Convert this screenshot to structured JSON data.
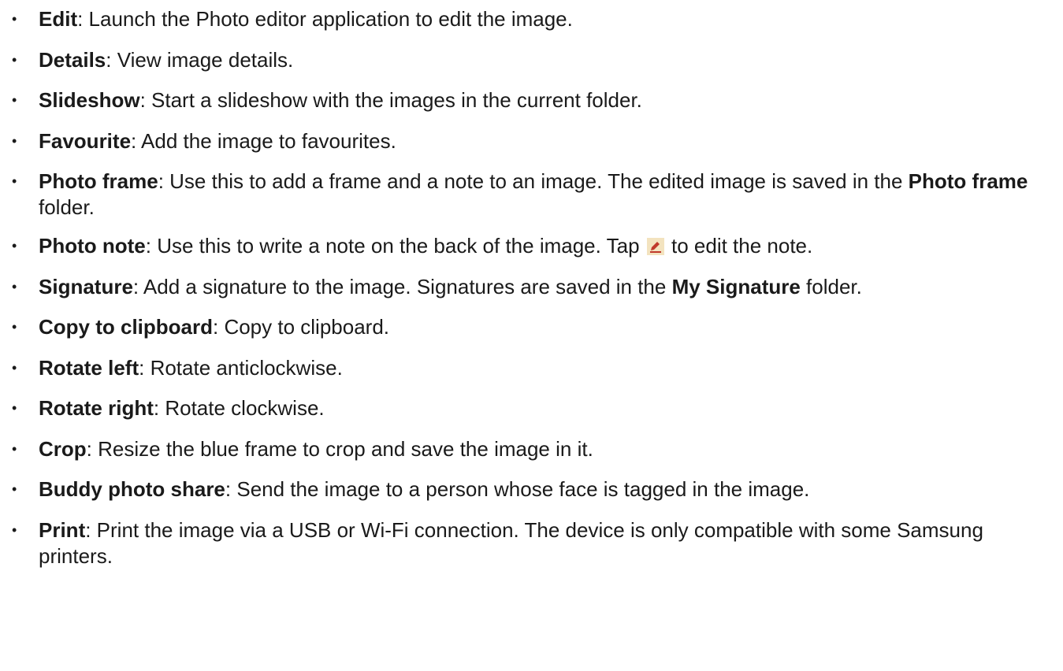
{
  "items": [
    {
      "term": "Edit",
      "desc": ": Launch the Photo editor application to edit the image."
    },
    {
      "term": "Details",
      "desc": ": View image details."
    },
    {
      "term": "Slideshow",
      "desc": ": Start a slideshow with the images in the current folder."
    },
    {
      "term": "Favourite",
      "desc": ": Add the image to favourites."
    },
    {
      "term": "Photo frame",
      "desc": ": Use this to add a frame and a note to an image. The edited image is saved in the ",
      "bold2": "Photo frame",
      "desc2": " folder."
    },
    {
      "term": "Photo note",
      "desc": ": Use this to write a note on the back of the image. Tap ",
      "icon": "pencil-edit-icon",
      "desc2": " to edit the note."
    },
    {
      "term": "Signature",
      "desc": ": Add a signature to the image. Signatures are saved in the ",
      "bold2": "My Signature",
      "desc2": " folder."
    },
    {
      "term": "Copy to clipboard",
      "desc": ": Copy to clipboard."
    },
    {
      "term": "Rotate left",
      "desc": ": Rotate anticlockwise."
    },
    {
      "term": "Rotate right",
      "desc": ": Rotate clockwise."
    },
    {
      "term": "Crop",
      "desc": ": Resize the blue frame to crop and save the image in it."
    },
    {
      "term": "Buddy photo share",
      "desc": ": Send the image to a person whose face is tagged in the image."
    },
    {
      "term": "Print",
      "desc": ": Print the image via a USB or Wi-Fi connection. The device is only compatible with some Samsung printers."
    }
  ],
  "colors": {
    "text": "#1a1a1a",
    "icon_bg": "#f3e3bf",
    "icon_fg": "#c0392b"
  }
}
